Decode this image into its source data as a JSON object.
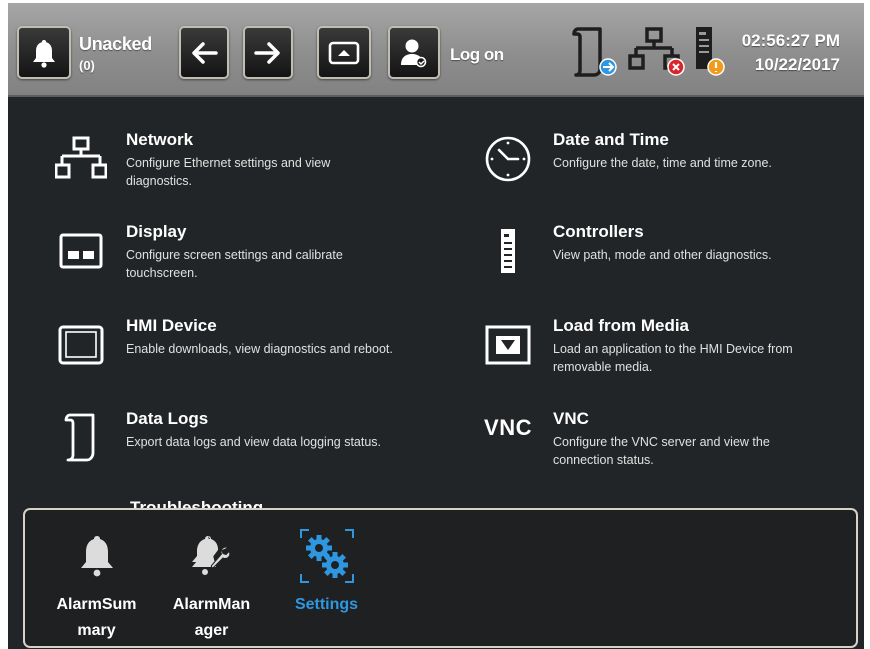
{
  "header": {
    "alarm_button_label": "Unacked",
    "alarm_count": "(0)",
    "logon_label": "Log on",
    "time": "02:56:27 PM",
    "date": "10/22/2017"
  },
  "settings": [
    {
      "title": "Network",
      "description": "Configure Ethernet settings and view diagnostics.",
      "icon": "network-icon"
    },
    {
      "title": "Date and Time",
      "description": "Configure the date, time and time zone.",
      "icon": "clock-icon"
    },
    {
      "title": "Display",
      "description": "Configure screen settings and calibrate touchscreen.",
      "icon": "display-icon"
    },
    {
      "title": "Controllers",
      "description": "View path, mode and other diagnostics.",
      "icon": "controller-icon"
    },
    {
      "title": "HMI Device",
      "description": "Enable downloads, view diagnostics and reboot.",
      "icon": "hmi-device-icon"
    },
    {
      "title": "Load from Media",
      "description": "Load an application to the HMI Device from removable media.",
      "icon": "load-media-icon"
    },
    {
      "title": "Data Logs",
      "description": "Export data logs and view data logging status.",
      "icon": "scroll-icon"
    },
    {
      "title": "VNC",
      "description": "Configure the VNC server and view the connection status.",
      "icon_text": "VNC"
    },
    {
      "title": "Troubleshooting"
    }
  ],
  "popup": {
    "items": [
      {
        "label": "AlarmSum\nmary",
        "icon": "bell-icon"
      },
      {
        "label": "AlarmMan\nager",
        "icon": "bell-wrench-icon"
      },
      {
        "label": "Settings",
        "icon": "gears-icon",
        "active": true
      }
    ]
  },
  "colors": {
    "accent": "#2f97e0",
    "background": "#222527",
    "topbar": "#959595",
    "status_ok": "#2f97e0",
    "status_error": "#d8262b",
    "status_warning": "#f29a1c"
  }
}
